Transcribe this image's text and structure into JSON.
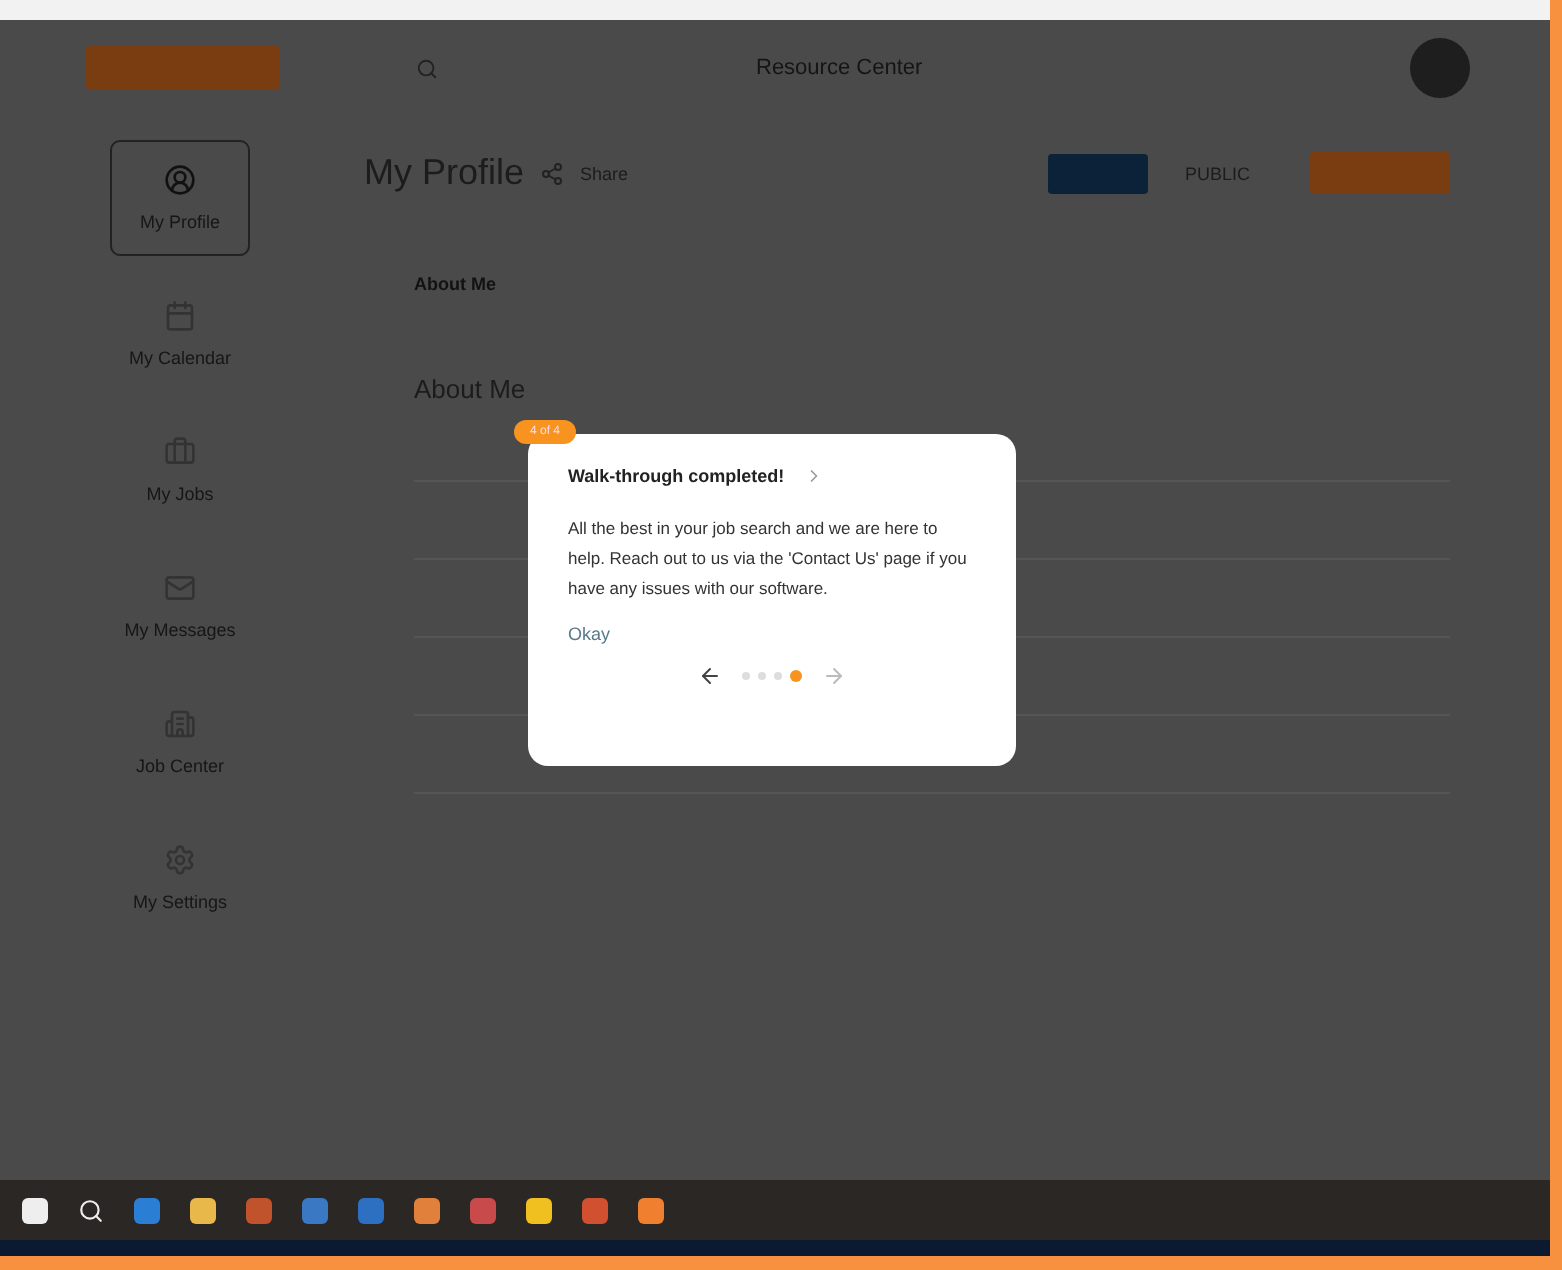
{
  "header": {
    "link": "Resource Center"
  },
  "sidebar": {
    "items": [
      {
        "label": "My Profile",
        "selected": true
      },
      {
        "label": "My Calendar",
        "selected": false
      },
      {
        "label": "My Jobs",
        "selected": false
      },
      {
        "label": "My Messages",
        "selected": false
      },
      {
        "label": "Job Center",
        "selected": false
      },
      {
        "label": "My Settings",
        "selected": false
      }
    ]
  },
  "profile": {
    "title": "My Profile",
    "share": "Share",
    "visibility": "PUBLIC",
    "tabs": [
      {
        "label": "About Me",
        "selected": true
      }
    ],
    "section_title": "About Me"
  },
  "walkthrough": {
    "step": "4 of 4",
    "title": "Walk-through completed!",
    "body": "All the best in your job search and we are here to help. Reach out to us via the 'Contact Us' page if you have any issues with our software.",
    "okay": "Okay",
    "dots": [
      {
        "selected": false
      },
      {
        "selected": false
      },
      {
        "selected": false
      },
      {
        "selected": true
      }
    ]
  }
}
